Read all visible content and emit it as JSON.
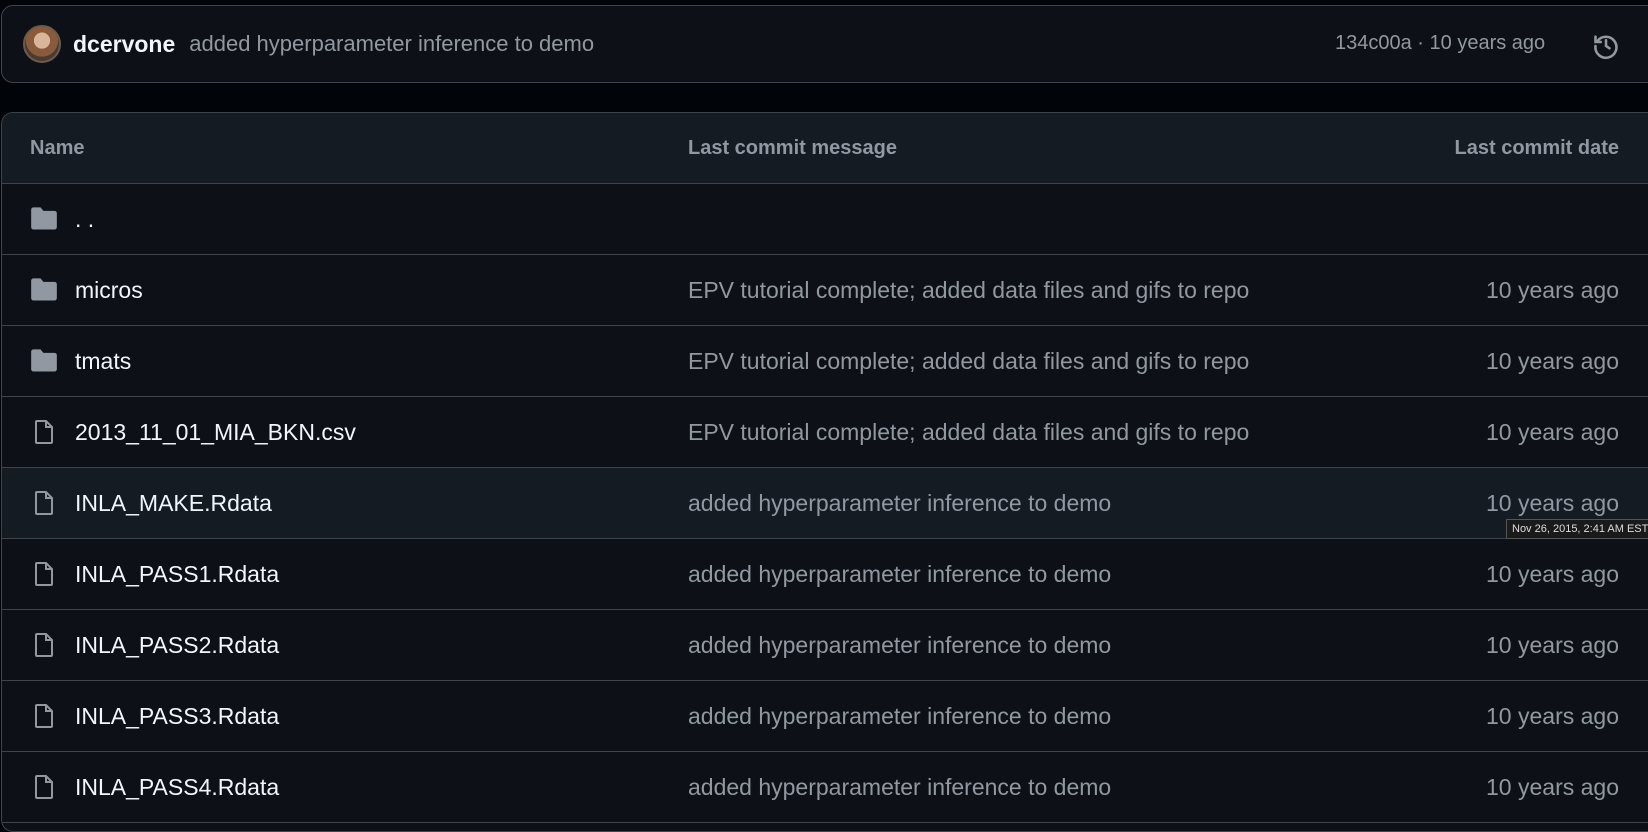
{
  "latest_commit": {
    "author": "dcervone",
    "message": "added hyperparameter inference to demo",
    "sha": "134c00a",
    "separator": " · ",
    "age": "10 years ago",
    "history_icon": "history-icon"
  },
  "table": {
    "headers": {
      "name": "Name",
      "message": "Last commit message",
      "date": "Last commit date"
    },
    "rows": [
      {
        "type": "folder",
        "name": ". .",
        "message": "",
        "date": ""
      },
      {
        "type": "folder",
        "name": "micros",
        "message": "EPV tutorial complete; added data files and gifs to repo",
        "date": "10 years ago"
      },
      {
        "type": "folder",
        "name": "tmats",
        "message": "EPV tutorial complete; added data files and gifs to repo",
        "date": "10 years ago"
      },
      {
        "type": "file",
        "name": "2013_11_01_MIA_BKN.csv",
        "message": "EPV tutorial complete; added data files and gifs to repo",
        "date": "10 years ago"
      },
      {
        "type": "file",
        "name": "INLA_MAKE.Rdata",
        "message": "added hyperparameter inference to demo",
        "date": "10 years ago",
        "hovered": true
      },
      {
        "type": "file",
        "name": "INLA_PASS1.Rdata",
        "message": "added hyperparameter inference to demo",
        "date": "10 years ago"
      },
      {
        "type": "file",
        "name": "INLA_PASS2.Rdata",
        "message": "added hyperparameter inference to demo",
        "date": "10 years ago"
      },
      {
        "type": "file",
        "name": "INLA_PASS3.Rdata",
        "message": "added hyperparameter inference to demo",
        "date": "10 years ago"
      },
      {
        "type": "file",
        "name": "INLA_PASS4.Rdata",
        "message": "added hyperparameter inference to demo",
        "date": "10 years ago"
      }
    ]
  },
  "tooltip": "Nov 26, 2015, 2:41 AM EST"
}
